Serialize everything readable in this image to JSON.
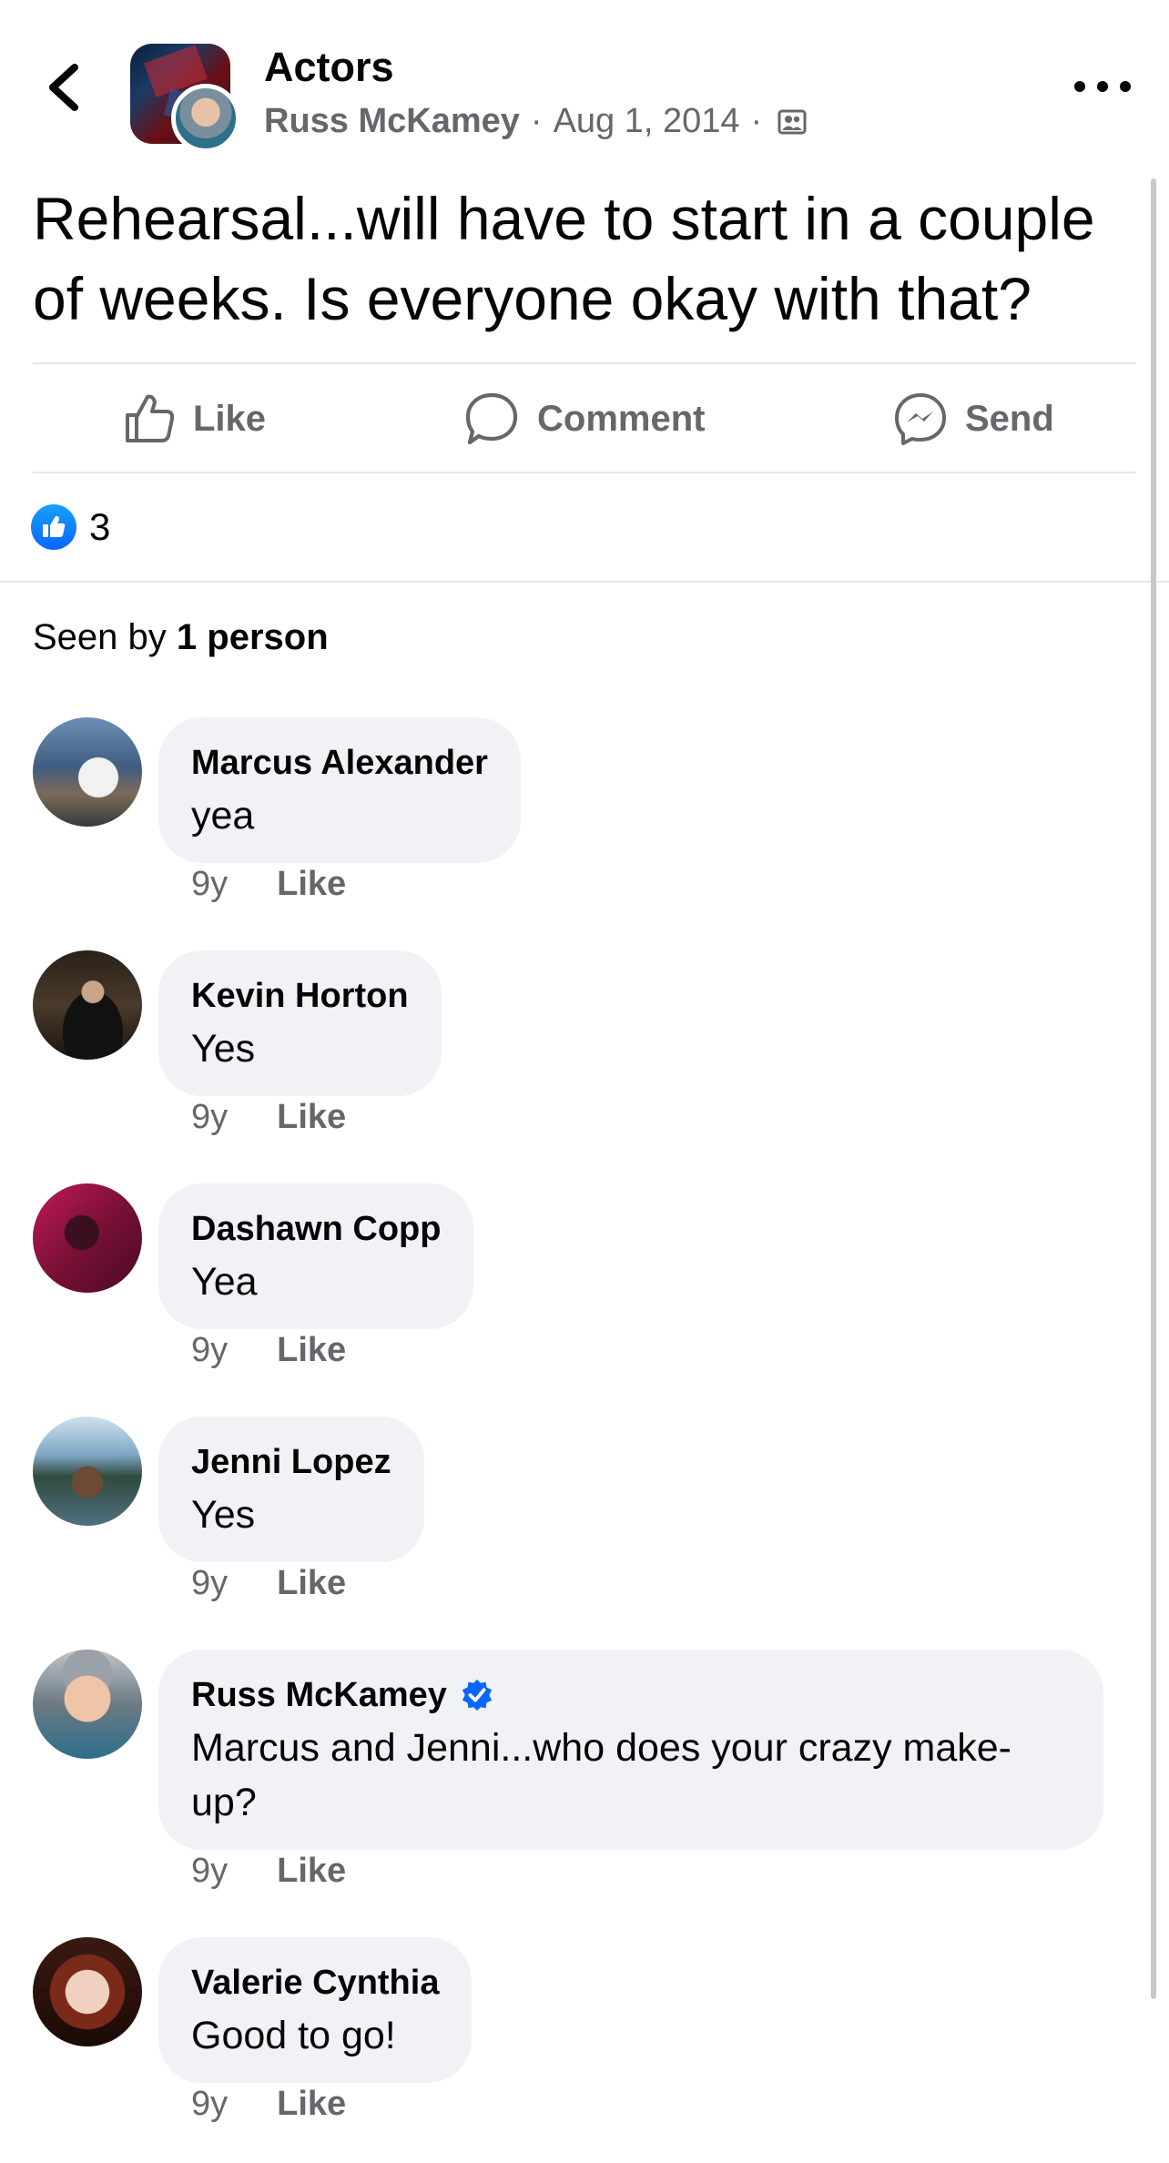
{
  "header": {
    "title": "Actors",
    "author": "Russ McKamey",
    "separator": "·",
    "date": "Aug 1, 2014",
    "audience_icon": "group-audience-icon"
  },
  "post": {
    "text": "Rehearsal...will have to start in a couple of weeks. Is everyone okay with that?"
  },
  "actions": {
    "like": "Like",
    "comment": "Comment",
    "send": "Send"
  },
  "reactions": {
    "icon": "like-reaction-icon",
    "count": "3"
  },
  "seen": {
    "prefix": "Seen by",
    "count": "1 person"
  },
  "comments": [
    {
      "name": "Marcus Alexander",
      "text": "yea",
      "time": "9y",
      "like": "Like"
    },
    {
      "name": "Kevin Horton",
      "text": "Yes",
      "time": "9y",
      "like": "Like"
    },
    {
      "name": "Dashawn Copp",
      "text": "Yea",
      "time": "9y",
      "like": "Like"
    },
    {
      "name": "Jenni Lopez",
      "text": "Yes",
      "time": "9y",
      "like": "Like"
    },
    {
      "name": "Russ McKamey",
      "text": "Marcus and Jenni...who does your crazy make-up?",
      "time": "9y",
      "like": "Like",
      "verified": true
    },
    {
      "name": "Valerie Cynthia",
      "text": "Good to go!",
      "time": "9y",
      "like": "Like"
    }
  ],
  "colors": {
    "primary_text": "#050505",
    "secondary_text": "#65676b",
    "bubble": "#f0f2f5",
    "accent_blue": "#0866ff",
    "divider": "#e4e6eb"
  }
}
